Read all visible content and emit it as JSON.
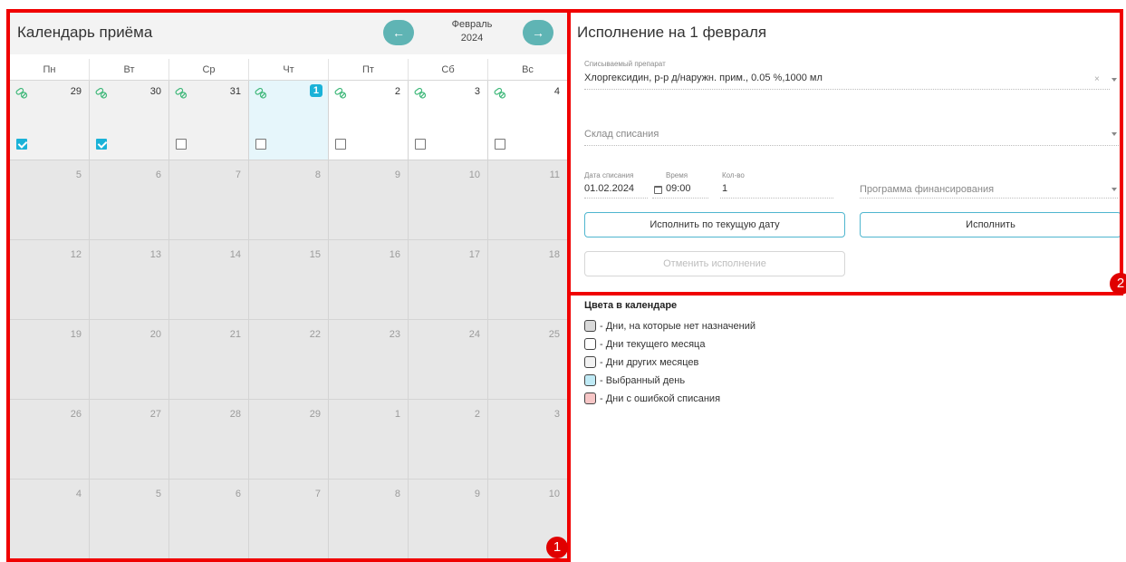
{
  "calendar": {
    "title": "Календарь приёма",
    "month": "Февраль",
    "year": "2024",
    "prev_icon": "arrow-left-icon",
    "next_icon": "arrow-right-icon",
    "weekdays": [
      "Пн",
      "Вт",
      "Ср",
      "Чт",
      "Пт",
      "Сб",
      "Вс"
    ],
    "first_week": [
      {
        "day": "29",
        "checked": true,
        "kind": "prev"
      },
      {
        "day": "30",
        "checked": true,
        "kind": "prev"
      },
      {
        "day": "31",
        "checked": false,
        "kind": "prev"
      },
      {
        "day": "1",
        "checked": false,
        "kind": "selected"
      },
      {
        "day": "2",
        "checked": false,
        "kind": "current"
      },
      {
        "day": "3",
        "checked": false,
        "kind": "current"
      },
      {
        "day": "4",
        "checked": false,
        "kind": "current"
      }
    ],
    "other_weeks": [
      [
        "5",
        "6",
        "7",
        "8",
        "9",
        "10",
        "11"
      ],
      [
        "12",
        "13",
        "14",
        "15",
        "16",
        "17",
        "18"
      ],
      [
        "19",
        "20",
        "21",
        "22",
        "23",
        "24",
        "25"
      ],
      [
        "26",
        "27",
        "28",
        "29",
        "1",
        "2",
        "3"
      ],
      [
        "4",
        "5",
        "6",
        "7",
        "8",
        "9",
        "10"
      ]
    ]
  },
  "markers": [
    "1",
    "2"
  ],
  "execution": {
    "title": "Исполнение на 1 февраля",
    "drug_label": "Списываемый препарат",
    "drug_value": "Хлоргексидин, р-р д/наружн. прим., 0.05 %,1000 мл",
    "clear_symbol": "×",
    "warehouse_placeholder": "Склад списания",
    "date_label": "Дата списания",
    "date_value": "01.02.2024",
    "time_label": "Время",
    "time_value": "09:00",
    "qty_label": "Кол-во",
    "qty_value": "1",
    "program_placeholder": "Программа финансирования",
    "btn_execute_today": "Исполнить по текущую дату",
    "btn_execute": "Исполнить",
    "btn_cancel": "Отменить исполнение"
  },
  "legend": {
    "title": "Цвета в календаре",
    "items": [
      {
        "label": "- Дни, на которые нет назначений",
        "color": "#d9d9d9"
      },
      {
        "label": "- Дни текущего месяца",
        "color": "#ffffff"
      },
      {
        "label": "- Дни других месяцев",
        "color": "#f2f2f2"
      },
      {
        "label": "- Выбранный день",
        "color": "#bfeaf5"
      },
      {
        "label": "- Дни с ошибкой списания",
        "color": "#f7c6c6"
      }
    ]
  },
  "colors": {
    "accent": "#1ab2d8",
    "nav_button": "#5fb4b4",
    "pill_icon": "#3fb87a",
    "highlight_frame": "#f00000"
  }
}
